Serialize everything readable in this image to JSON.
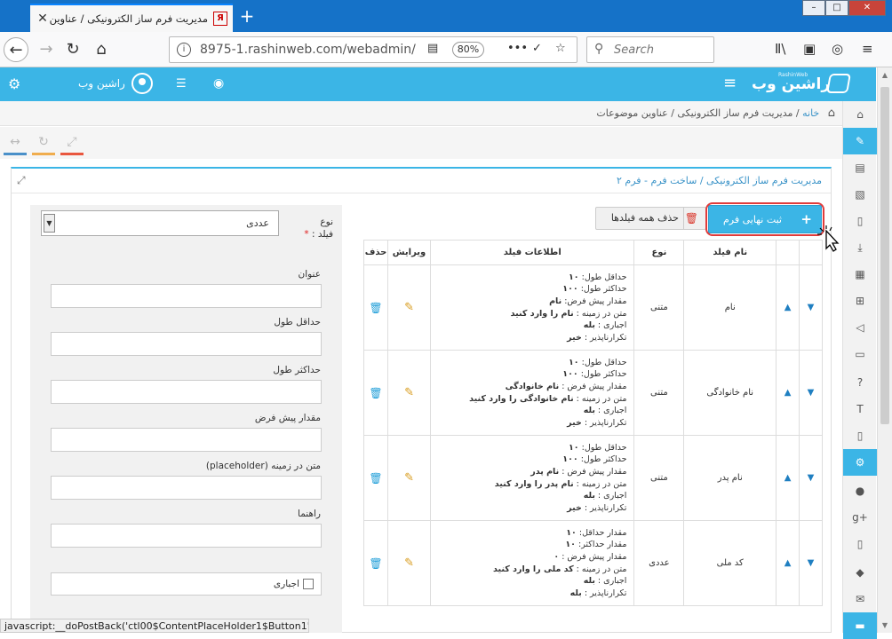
{
  "browser": {
    "tab_title": "مدیریت فرم ساز الکترونیکی / عناوین",
    "url": "8975-1.rashinweb.com/webadmin/",
    "zoom": "80%",
    "search_placeholder": "Search"
  },
  "header": {
    "user_name": "راشین وب",
    "logo_text": "راشین وب",
    "logo_small": "RashinWeb"
  },
  "breadcrumb": {
    "home": "خانه",
    "sep": " / ",
    "item1": "مدیریت فرم ساز الکترونیکی",
    "item2": "عناوین موضوعات"
  },
  "panel": {
    "title": "مدیریت فرم ساز الکترونیکی / ساخت فرم - فرم ۲"
  },
  "buttons": {
    "final_submit": "ثبت نهایی فرم",
    "delete_all": "حذف همه فیلدها"
  },
  "table": {
    "headers": {
      "name": "نام فیلد",
      "type": "نوع",
      "info": "اطلاعات فیلد",
      "edit": "ویرایش",
      "delete": "حذف"
    },
    "rows": [
      {
        "name": "نام",
        "type": "متنی",
        "lines": [
          {
            "k": "حداقل طول: ",
            "v": "۱۰"
          },
          {
            "k": "حداکثر طول: ",
            "v": "۱۰۰"
          },
          {
            "k": "مقدار پیش فرض: ",
            "v": "نام"
          },
          {
            "k": "متن در زمینه : ",
            "v": "نام را وارد کنید"
          },
          {
            "k": "اجباری : ",
            "v": "بله"
          },
          {
            "k": "تکرارناپذیر : ",
            "v": "خیر"
          }
        ]
      },
      {
        "name": "نام خانوادگی",
        "type": "متنی",
        "lines": [
          {
            "k": "حداقل طول: ",
            "v": "۱۰"
          },
          {
            "k": "حداکثر طول: ",
            "v": "۱۰۰"
          },
          {
            "k": "مقدار پیش فرض : ",
            "v": "نام خانوادگی"
          },
          {
            "k": "متن در زمینه : ",
            "v": "نام خانوادگی را وارد کنید"
          },
          {
            "k": "اجباری : ",
            "v": "بله"
          },
          {
            "k": "تکرارناپذیر : ",
            "v": "خیر"
          }
        ]
      },
      {
        "name": "نام پدر",
        "type": "متنی",
        "lines": [
          {
            "k": "حداقل طول: ",
            "v": "۱۰"
          },
          {
            "k": "حداکثر طول: ",
            "v": "۱۰۰"
          },
          {
            "k": "مقدار پیش فرض : ",
            "v": "نام پدر"
          },
          {
            "k": "متن در زمینه : ",
            "v": "نام پدر را وارد کنید"
          },
          {
            "k": "اجباری : ",
            "v": "بله"
          },
          {
            "k": "تکرارناپذیر : ",
            "v": "خیر"
          }
        ]
      },
      {
        "name": "کد ملی",
        "type": "عددی",
        "lines": [
          {
            "k": "مقدار حداقل: ",
            "v": "۱۰"
          },
          {
            "k": "مقدار حداکثر: ",
            "v": "۱۰"
          },
          {
            "k": "مقدار پیش فرض : ",
            "v": "۰"
          },
          {
            "k": "متن در زمینه : ",
            "v": "کد ملی را وارد کنید"
          },
          {
            "k": "اجباری : ",
            "v": "بله"
          },
          {
            "k": "تکرارناپذیر : ",
            "v": "بله"
          }
        ]
      }
    ]
  },
  "editor": {
    "type_label_1": "نوع",
    "type_label_2": "فیلد :",
    "required_mark": "*",
    "type_value": "عددی",
    "title_label": "عنوان",
    "min_label": "حداقل طول",
    "max_label": "حداکثر طول",
    "default_label": "مقدار پیش فرض",
    "placeholder_label": "متن در زمینه (placeholder)",
    "hint_label": "راهنما",
    "required_label": "اجباری"
  },
  "status": "javascript:__doPostBack('ctl00$ContentPlaceHolder1$Button1','')",
  "colors": {
    "accent": "#3bb5e6",
    "titlebar": "#1572c8",
    "danger": "#d9362b"
  }
}
